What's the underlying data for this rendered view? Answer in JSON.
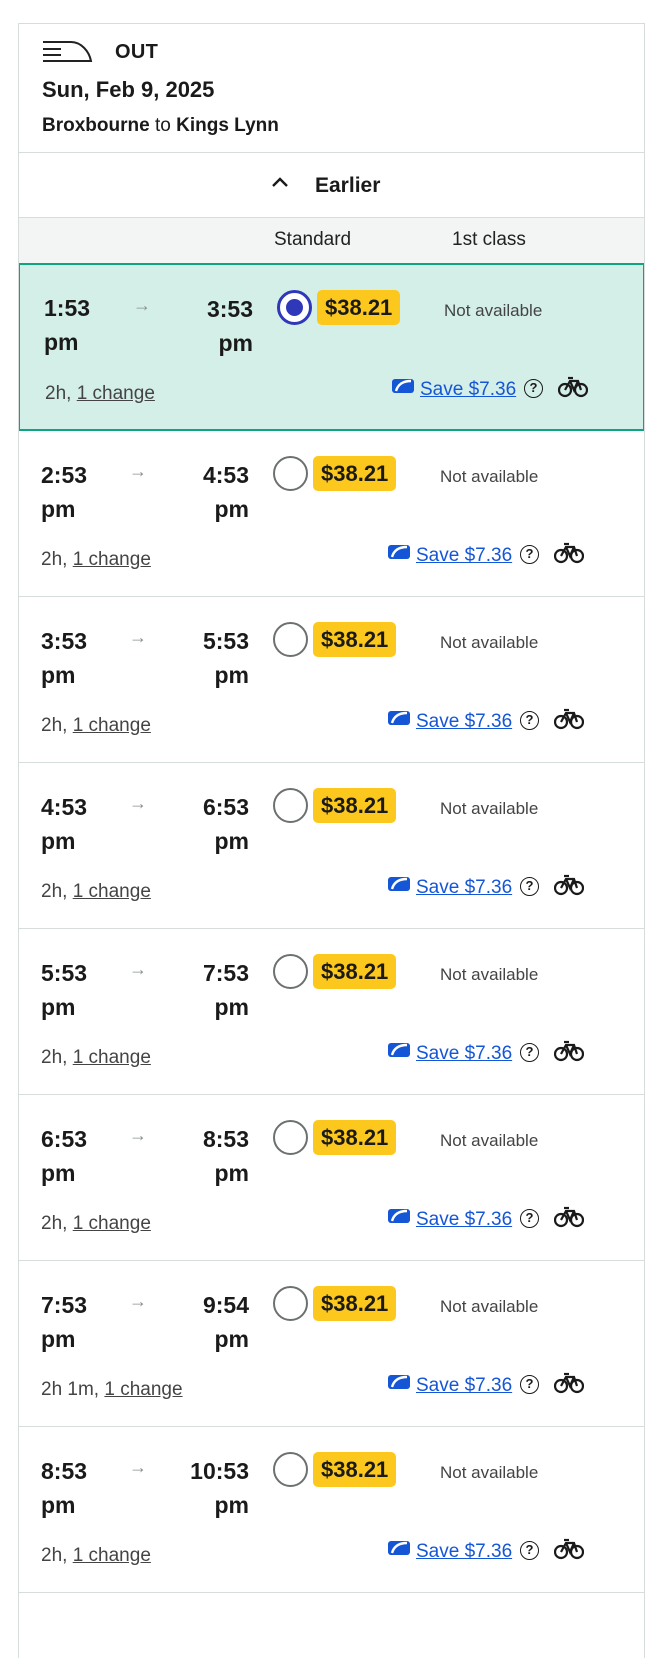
{
  "journey": {
    "direction": "OUT",
    "date": "Sun, Feb 9, 2025",
    "origin": "Broxbourne",
    "connector": "to",
    "destination": "Kings Lynn"
  },
  "earlier_label": "Earlier",
  "columns": {
    "standard": "Standard",
    "first": "1st class"
  },
  "icons": {
    "train": "train-icon",
    "chevron": "chevron-up-icon",
    "railcard": "railcard-icon",
    "help": "help-icon",
    "bike": "bicycle-icon"
  },
  "colors": {
    "selected_bg": "#d4efe8",
    "selected_border": "#10a37f",
    "price_bg": "#fdc81e",
    "link": "#1556d6",
    "radio_checked": "#2e38b8"
  },
  "trains": [
    {
      "dep": "1:53",
      "dep_ampm": "pm",
      "arr": "3:53",
      "arr_ampm": "pm",
      "price": "$38.21",
      "first": "Not available",
      "duration": "2h,",
      "changes": "1 change",
      "save": "Save $7.36",
      "selected": true
    },
    {
      "dep": "2:53",
      "dep_ampm": "pm",
      "arr": "4:53",
      "arr_ampm": "pm",
      "price": "$38.21",
      "first": "Not available",
      "duration": "2h,",
      "changes": "1 change",
      "save": "Save $7.36",
      "selected": false
    },
    {
      "dep": "3:53",
      "dep_ampm": "pm",
      "arr": "5:53",
      "arr_ampm": "pm",
      "price": "$38.21",
      "first": "Not available",
      "duration": "2h,",
      "changes": "1 change",
      "save": "Save $7.36",
      "selected": false
    },
    {
      "dep": "4:53",
      "dep_ampm": "pm",
      "arr": "6:53",
      "arr_ampm": "pm",
      "price": "$38.21",
      "first": "Not available",
      "duration": "2h,",
      "changes": "1 change",
      "save": "Save $7.36",
      "selected": false
    },
    {
      "dep": "5:53",
      "dep_ampm": "pm",
      "arr": "7:53",
      "arr_ampm": "pm",
      "price": "$38.21",
      "first": "Not available",
      "duration": "2h,",
      "changes": "1 change",
      "save": "Save $7.36",
      "selected": false
    },
    {
      "dep": "6:53",
      "dep_ampm": "pm",
      "arr": "8:53",
      "arr_ampm": "pm",
      "price": "$38.21",
      "first": "Not available",
      "duration": "2h,",
      "changes": "1 change",
      "save": "Save $7.36",
      "selected": false
    },
    {
      "dep": "7:53",
      "dep_ampm": "pm",
      "arr": "9:54",
      "arr_ampm": "pm",
      "price": "$38.21",
      "first": "Not available",
      "duration": "2h 1m,",
      "changes": "1 change",
      "save": "Save $7.36",
      "selected": false
    },
    {
      "dep": "8:53",
      "dep_ampm": "pm",
      "arr": "10:53",
      "arr_ampm": "pm",
      "price": "$38.21",
      "first": "Not available",
      "duration": "2h,",
      "changes": "1 change",
      "save": "Save $7.36",
      "selected": false
    }
  ]
}
